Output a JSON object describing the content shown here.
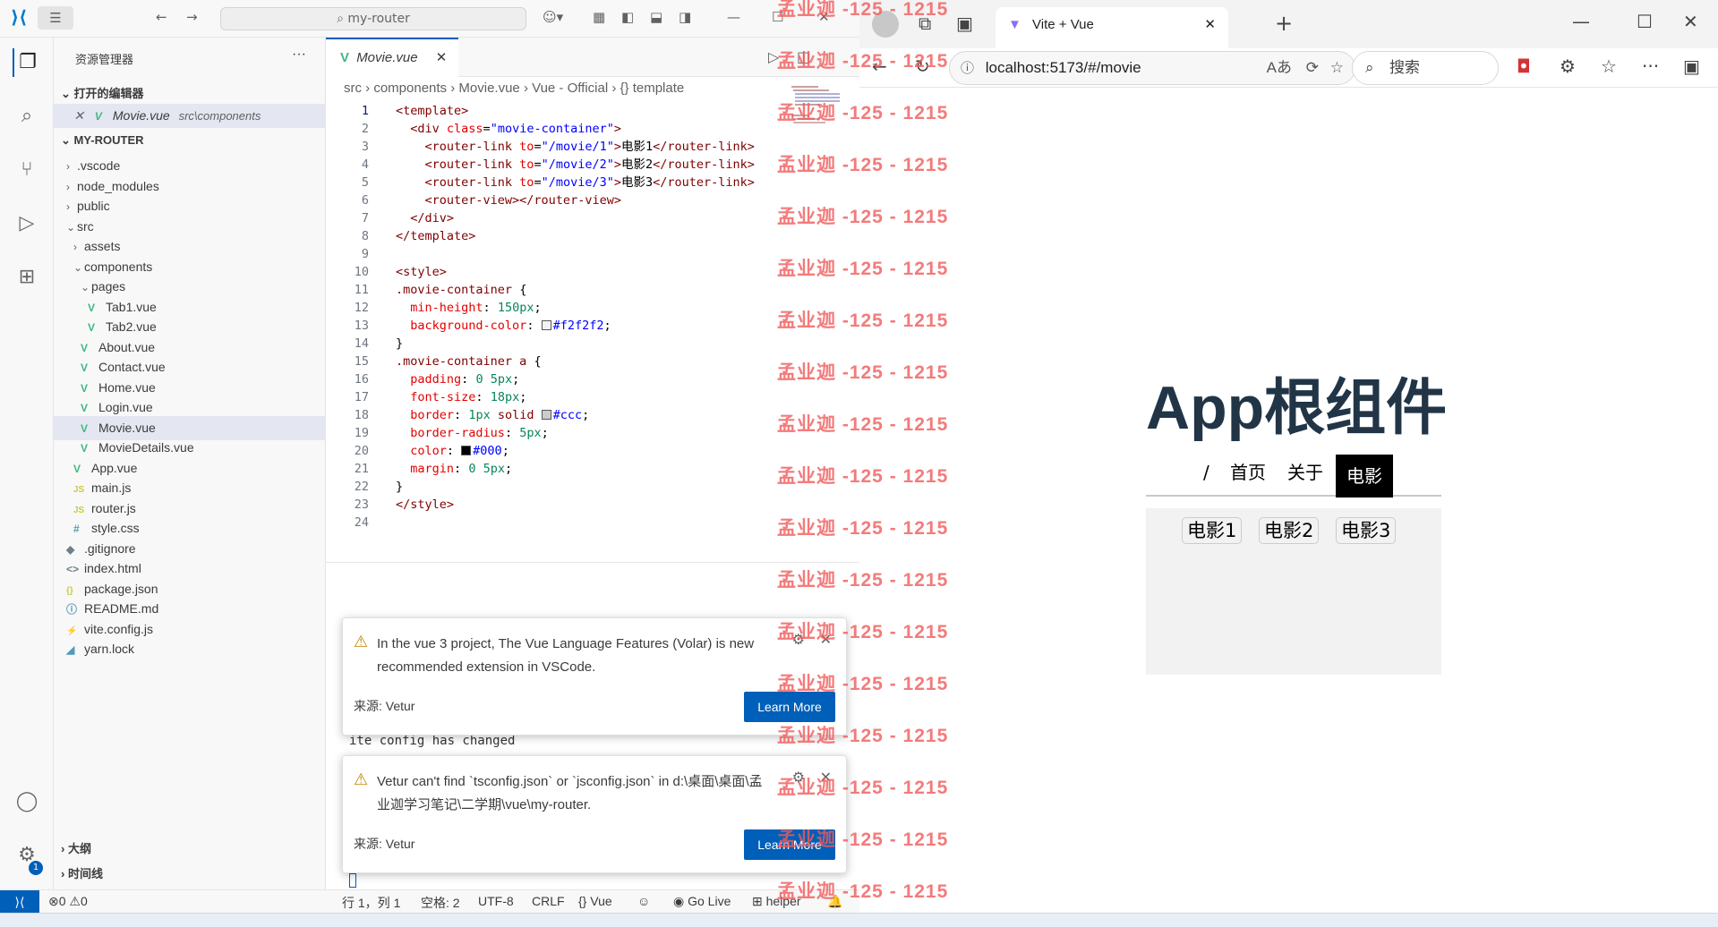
{
  "vscode": {
    "search_placeholder": "my-router",
    "explorer_title": "资源管理器",
    "open_editors_label": "打开的编辑器",
    "open_editor_file": "Movie.vue",
    "open_editor_path": "src\\components",
    "project_label": "MY-ROUTER",
    "tree": [
      {
        "label": ".vscode",
        "icon": "chevron-right"
      },
      {
        "label": "node_modules",
        "icon": "chevron-right"
      },
      {
        "label": "public",
        "icon": "chevron-right"
      },
      {
        "label": "src",
        "icon": "chevron-down"
      },
      {
        "label": "assets",
        "icon": "chevron-right"
      },
      {
        "label": "components",
        "icon": "chevron-down"
      },
      {
        "label": "pages",
        "icon": "chevron-down"
      },
      {
        "label": "Tab1.vue",
        "icon": "vue"
      },
      {
        "label": "Tab2.vue",
        "icon": "vue"
      },
      {
        "label": "About.vue",
        "icon": "vue"
      },
      {
        "label": "Contact.vue",
        "icon": "vue"
      },
      {
        "label": "Home.vue",
        "icon": "vue"
      },
      {
        "label": "Login.vue",
        "icon": "vue"
      },
      {
        "label": "Movie.vue",
        "icon": "vue"
      },
      {
        "label": "MovieDetails.vue",
        "icon": "vue"
      },
      {
        "label": "App.vue",
        "icon": "vue"
      },
      {
        "label": "main.js",
        "icon": "js"
      },
      {
        "label": "router.js",
        "icon": "js"
      },
      {
        "label": "style.css",
        "icon": "css"
      },
      {
        "label": ".gitignore",
        "icon": "git"
      },
      {
        "label": "index.html",
        "icon": "html"
      },
      {
        "label": "package.json",
        "icon": "json"
      },
      {
        "label": "README.md",
        "icon": "info"
      },
      {
        "label": "vite.config.js",
        "icon": "vite"
      },
      {
        "label": "yarn.lock",
        "icon": "yarn"
      }
    ],
    "outline_label": "大纲",
    "timeline_label": "时间线",
    "tab_label": "Movie.vue",
    "breadcrumb": [
      "src",
      "components",
      "Movie.vue",
      "Vue - Official",
      "{} template"
    ],
    "code_lines": [
      "<template>",
      "  <div class=\"movie-container\">",
      "    <router-link to=\"/movie/1\">电影1</router-link>",
      "    <router-link to=\"/movie/2\">电影2</router-link>",
      "    <router-link to=\"/movie/3\">电影3</router-link>",
      "    <router-view></router-view>",
      "  </div>",
      "</template>",
      "",
      "<style>",
      ".movie-container {",
      "  min-height: 150px;",
      "  background-color: #f2f2f2;",
      "}",
      ".movie-container a {",
      "  padding: 0 5px;",
      "  font-size: 18px;",
      "  border: 1px solid #ccc;",
      "  border-radius: 5px;",
      "  color: #000;",
      "  margin: 0 5px;",
      "}",
      "</style>",
      ""
    ],
    "terminal_text": "ite config has changed",
    "notifications": [
      {
        "message": "In the vue 3 project, The Vue Language Features (Volar) is new recommended extension in VSCode.",
        "source": "来源: Vetur",
        "button": "Learn More"
      },
      {
        "message": "Vetur can't find `tsconfig.json` or `jsconfig.json` in d:\\桌面\\桌面\\孟业迦学习笔记\\二学期\\vue\\my-router.",
        "source": "来源: Vetur",
        "button": "Learn More"
      }
    ],
    "status": {
      "errors": "0",
      "warnings": "0",
      "position": "行 1，列 1",
      "spaces": "空格: 2",
      "encoding": "UTF-8",
      "eol": "CRLF",
      "language": "Vue",
      "golive": "Go Live",
      "helper": "helper",
      "settings_badge": "1"
    },
    "colors": {
      "accent": "#005fb8",
      "vue_green": "#41b883"
    }
  },
  "browser": {
    "tab_title": "Vite + Vue",
    "url": "localhost:5173/#/movie",
    "search_label": "搜索",
    "app_title": "App根组件",
    "nav": [
      "/",
      "首页",
      "关于",
      "电影"
    ],
    "active_nav": "电影",
    "movies": [
      "电影1",
      "电影2",
      "电影3"
    ]
  },
  "watermark": "孟业迦 -125 - 1215"
}
